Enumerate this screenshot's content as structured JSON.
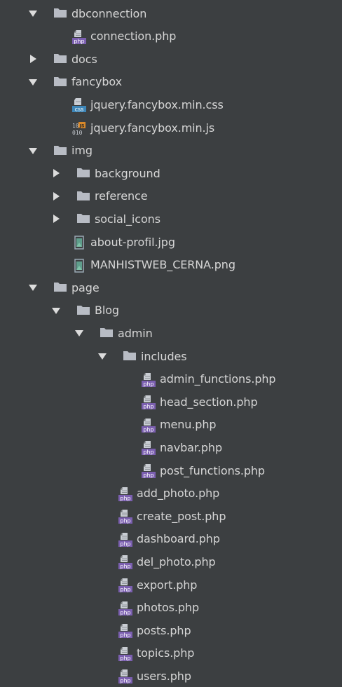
{
  "tree": [
    {
      "label": "dbconnection",
      "type": "folder",
      "depth": 0,
      "expanded": true,
      "icon": "folder-icon"
    },
    {
      "label": "connection.php",
      "type": "php",
      "depth": 1,
      "icon": "php-file-icon"
    },
    {
      "label": "docs",
      "type": "folder",
      "depth": 0,
      "expanded": false,
      "icon": "folder-icon"
    },
    {
      "label": "fancybox",
      "type": "folder",
      "depth": 0,
      "expanded": true,
      "icon": "folder-icon"
    },
    {
      "label": "jquery.fancybox.min.css",
      "type": "css",
      "depth": 1,
      "icon": "css-file-icon"
    },
    {
      "label": "jquery.fancybox.min.js",
      "type": "js",
      "depth": 1,
      "icon": "js-file-icon"
    },
    {
      "label": "img",
      "type": "folder",
      "depth": 0,
      "expanded": true,
      "icon": "folder-icon"
    },
    {
      "label": "background",
      "type": "folder",
      "depth": 1,
      "expanded": false,
      "icon": "folder-icon"
    },
    {
      "label": "reference",
      "type": "folder",
      "depth": 1,
      "expanded": false,
      "icon": "folder-icon"
    },
    {
      "label": "social_icons",
      "type": "folder",
      "depth": 1,
      "expanded": false,
      "icon": "folder-icon"
    },
    {
      "label": "about-profil.jpg",
      "type": "image",
      "depth": 1,
      "icon": "image-file-icon"
    },
    {
      "label": "MANHISTWEB_CERNA.png",
      "type": "image",
      "depth": 1,
      "icon": "image-file-icon"
    },
    {
      "label": "page",
      "type": "folder",
      "depth": 0,
      "expanded": true,
      "icon": "folder-icon"
    },
    {
      "label": "Blog",
      "type": "folder",
      "depth": 1,
      "expanded": true,
      "icon": "folder-icon"
    },
    {
      "label": "admin",
      "type": "folder",
      "depth": 2,
      "expanded": true,
      "icon": "folder-icon"
    },
    {
      "label": "includes",
      "type": "folder",
      "depth": 3,
      "expanded": true,
      "icon": "folder-icon"
    },
    {
      "label": "admin_functions.php",
      "type": "php",
      "depth": 4,
      "icon": "php-file-icon"
    },
    {
      "label": "head_section.php",
      "type": "php",
      "depth": 4,
      "icon": "php-file-icon"
    },
    {
      "label": "menu.php",
      "type": "php",
      "depth": 4,
      "icon": "php-file-icon"
    },
    {
      "label": "navbar.php",
      "type": "php",
      "depth": 4,
      "icon": "php-file-icon"
    },
    {
      "label": "post_functions.php",
      "type": "php",
      "depth": 4,
      "icon": "php-file-icon"
    },
    {
      "label": "add_photo.php",
      "type": "php",
      "depth": 3,
      "icon": "php-file-icon"
    },
    {
      "label": "create_post.php",
      "type": "php",
      "depth": 3,
      "icon": "php-file-icon"
    },
    {
      "label": "dashboard.php",
      "type": "php",
      "depth": 3,
      "icon": "php-file-icon"
    },
    {
      "label": "del_photo.php",
      "type": "php",
      "depth": 3,
      "icon": "php-file-icon"
    },
    {
      "label": "export.php",
      "type": "php",
      "depth": 3,
      "icon": "php-file-icon"
    },
    {
      "label": "photos.php",
      "type": "php",
      "depth": 3,
      "icon": "php-file-icon"
    },
    {
      "label": "posts.php",
      "type": "php",
      "depth": 3,
      "icon": "php-file-icon"
    },
    {
      "label": "topics.php",
      "type": "php",
      "depth": 3,
      "icon": "php-file-icon"
    },
    {
      "label": "users.php",
      "type": "php",
      "depth": 3,
      "icon": "php-file-icon"
    }
  ],
  "colors": {
    "background": "#3c3f41",
    "text": "#d6d6d6",
    "folder": "#b8bcc4",
    "arrow": "#dcdcdc",
    "php_badge": "#7b5fb0",
    "css_badge": "#3d86b8",
    "js_badge": "#d9892a",
    "image_frame": "#9aa8b4",
    "image_fill": "#5f9e8c"
  }
}
